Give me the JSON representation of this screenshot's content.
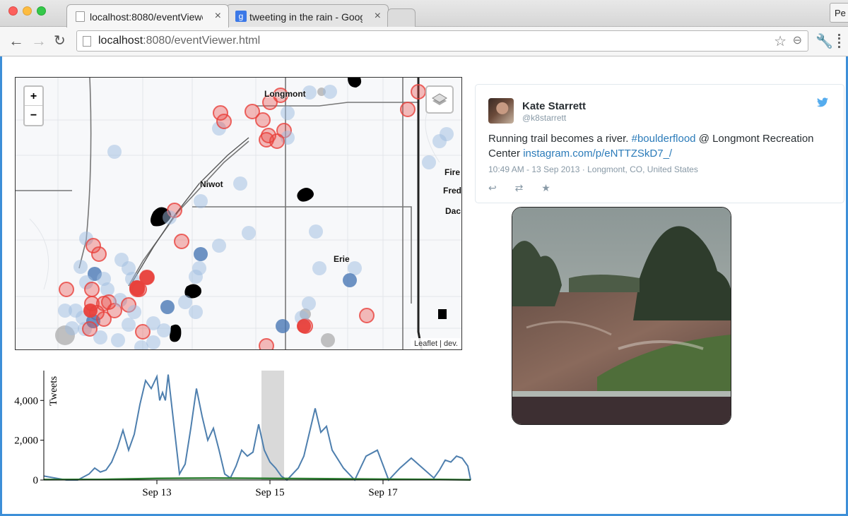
{
  "browser": {
    "tabs": [
      {
        "label": "localhost:8080/eventViewer",
        "close": "×"
      },
      {
        "label": "tweeting in the rain - Goog",
        "close": "×",
        "icon_letter": "g"
      }
    ],
    "profile_label": "Pe",
    "url_host": "localhost",
    "url_rest": ":8080/eventViewer.html",
    "icons": [
      "back-icon",
      "forward-icon",
      "reload-icon",
      "page-icon",
      "star-icon",
      "zoom-icon",
      "wrench-icon",
      "menu-icon"
    ]
  },
  "map": {
    "zoom_in": "+",
    "zoom_out": "−",
    "attribution": "Leaflet | dev.",
    "places": [
      "Longmont",
      "Niwot",
      "Erie",
      "Fire",
      "Fred",
      "Dac"
    ],
    "colors": {
      "blue_dot": "#9dbbe0",
      "dark_blue_dot": "#4a78b5",
      "red_dot": "#e8413c"
    }
  },
  "tweet": {
    "name": "Kate Starrett",
    "handle": "@k8starrett",
    "text_before": "Running trail becomes a river. ",
    "hashtag": "#boulderflood",
    "text_mid": " @ Longmont Recreation Center ",
    "link": "instagram.com/p/eNTTZSkD7_/",
    "meta": "10:49 AM - 13 Sep 2013 · Longmont, CO, United States",
    "actions": [
      "reply-icon",
      "retweet-icon",
      "favorite-icon"
    ],
    "bird_icon": "twitter-bird-icon"
  },
  "chart_data": {
    "type": "line",
    "ylabel": "Tweets",
    "yticks": [
      "0",
      "2,000",
      "4,000"
    ],
    "xticks": [
      "Sep 13",
      "Sep 15",
      "Sep 17"
    ],
    "ylim": [
      0,
      5500
    ],
    "xlim": [
      11.0,
      18.55
    ],
    "highlight_range": [
      14.85,
      15.25
    ],
    "series": [
      {
        "color": "#4e7fae",
        "x": [
          11.0,
          11.2,
          11.4,
          11.6,
          11.8,
          11.9,
          12.0,
          12.1,
          12.2,
          12.3,
          12.4,
          12.5,
          12.6,
          12.7,
          12.8,
          12.9,
          13.0,
          13.05,
          13.1,
          13.15,
          13.2,
          13.3,
          13.4,
          13.5,
          13.6,
          13.7,
          13.8,
          13.9,
          14.0,
          14.1,
          14.2,
          14.3,
          14.4,
          14.5,
          14.6,
          14.7,
          14.8,
          14.9,
          15.0,
          15.1,
          15.2,
          15.3,
          15.5,
          15.6,
          15.8,
          15.9,
          16.0,
          16.1,
          16.3,
          16.5,
          16.7,
          16.9,
          17.1,
          17.3,
          17.5,
          17.7,
          17.9,
          18.0,
          18.1,
          18.2,
          18.3,
          18.4,
          18.5,
          18.55
        ],
        "values": [
          200,
          100,
          0,
          0,
          300,
          600,
          400,
          500,
          900,
          1600,
          2500,
          1500,
          2300,
          3800,
          5000,
          4600,
          5200,
          4000,
          4400,
          4000,
          5300,
          2800,
          300,
          800,
          2600,
          4600,
          3200,
          2000,
          2600,
          1500,
          300,
          100,
          700,
          1500,
          1200,
          1400,
          2800,
          1500,
          900,
          600,
          200,
          0,
          600,
          1200,
          3600,
          2400,
          2700,
          1500,
          600,
          0,
          1200,
          1500,
          0,
          600,
          1100,
          600,
          100,
          500,
          1000,
          900,
          1200,
          1100,
          700,
          0
        ]
      },
      {
        "color": "#2e7d32",
        "x": [
          11.0,
          12.0,
          13.0,
          14.0,
          15.0,
          16.0,
          17.0,
          18.0,
          18.55
        ],
        "values": [
          20,
          30,
          80,
          100,
          80,
          60,
          40,
          30,
          10
        ]
      }
    ]
  }
}
